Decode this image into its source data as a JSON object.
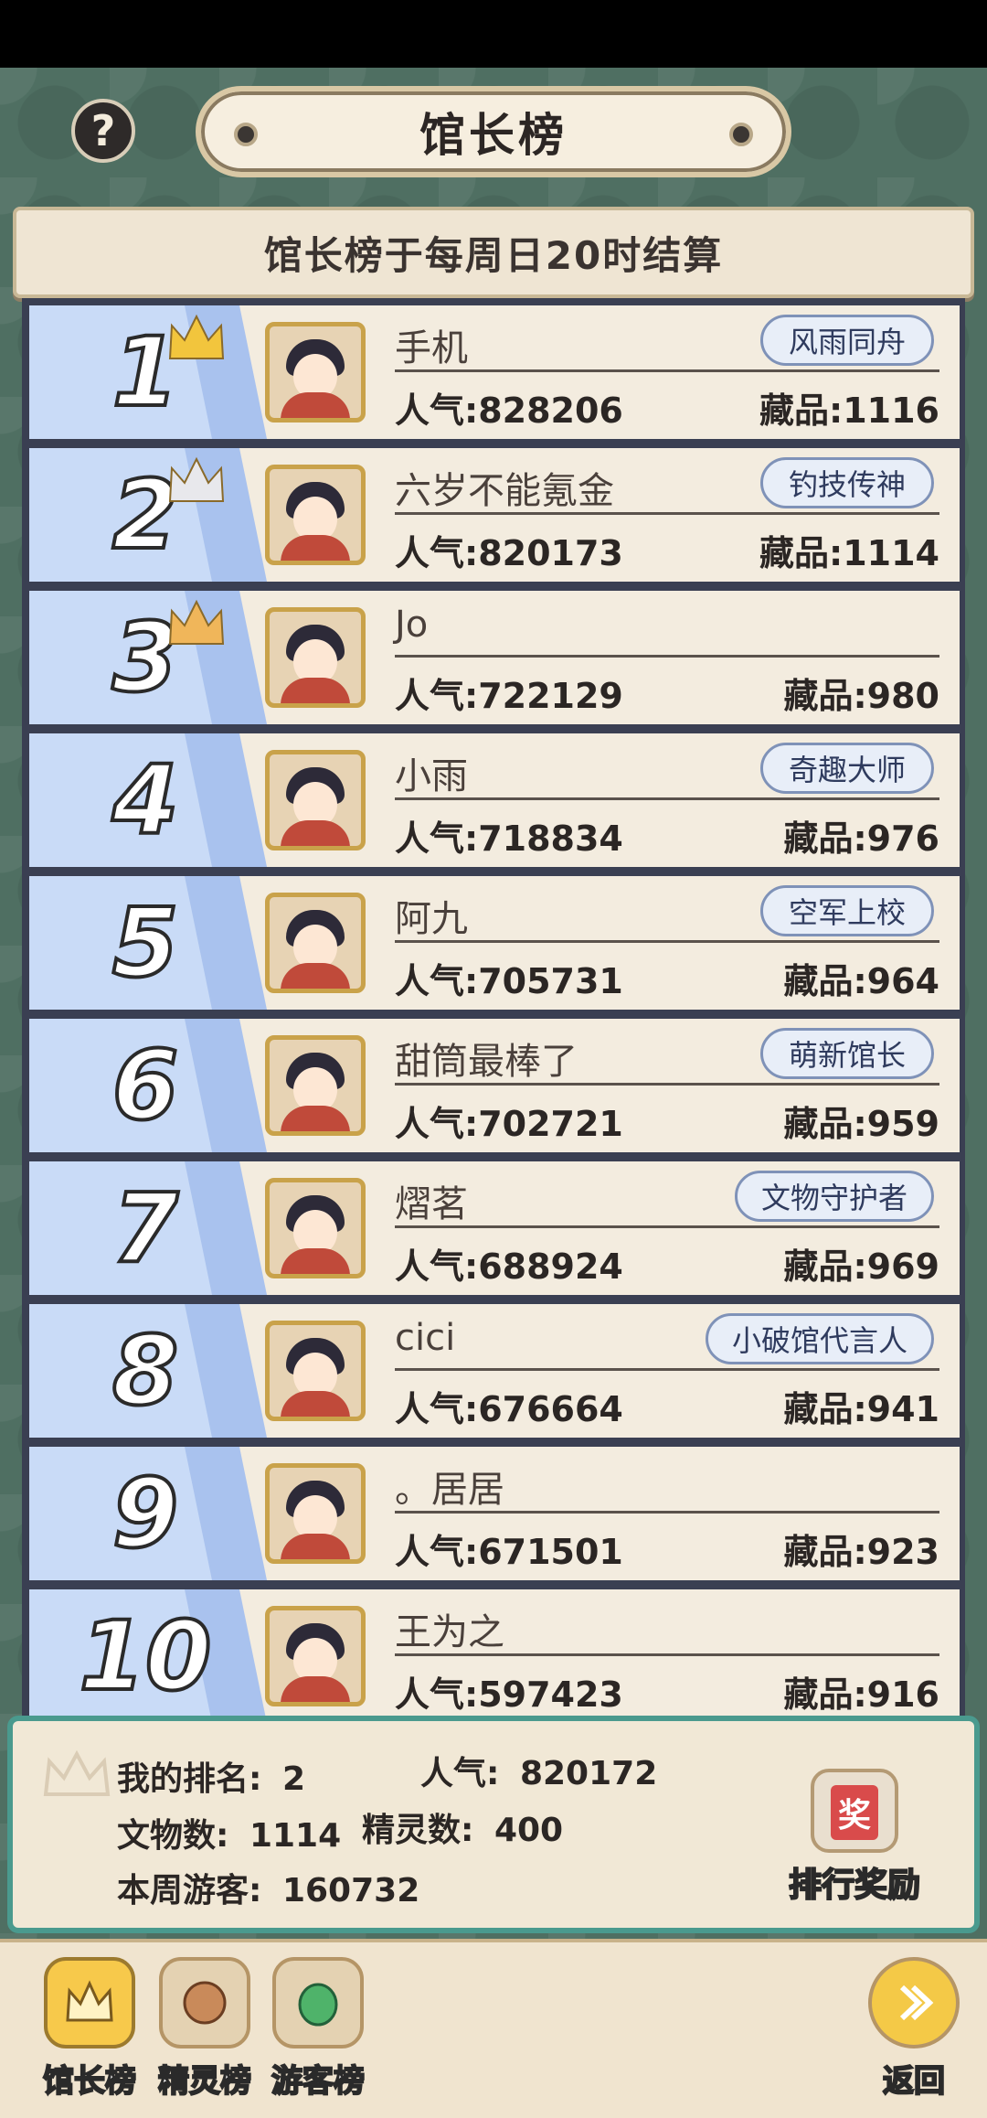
{
  "header": {
    "help_symbol": "?",
    "title": "馆长榜",
    "notice": "馆长榜于每周日20时结算"
  },
  "rows": [
    {
      "rank": "1",
      "name": "手机",
      "popularity": "人气:828206",
      "collection": "藏品:1116",
      "badge": "风雨同舟",
      "crown": "gold"
    },
    {
      "rank": "2",
      "name": "六岁不能氪金",
      "popularity": "人气:820173",
      "collection": "藏品:1114",
      "badge": "钓技传神",
      "crown": "silver"
    },
    {
      "rank": "3",
      "name": "Jo",
      "popularity": "人气:722129",
      "collection": "藏品:980",
      "badge": "",
      "crown": "bronze"
    },
    {
      "rank": "4",
      "name": "小雨",
      "popularity": "人气:718834",
      "collection": "藏品:976",
      "badge": "奇趣大师",
      "crown": ""
    },
    {
      "rank": "5",
      "name": "阿九",
      "popularity": "人气:705731",
      "collection": "藏品:964",
      "badge": "空军上校",
      "crown": ""
    },
    {
      "rank": "6",
      "name": "甜筒最棒了",
      "popularity": "人气:702721",
      "collection": "藏品:959",
      "badge": "萌新馆长",
      "crown": ""
    },
    {
      "rank": "7",
      "name": "熠茗",
      "popularity": "人气:688924",
      "collection": "藏品:969",
      "badge": "文物守护者",
      "crown": ""
    },
    {
      "rank": "8",
      "name": "cici",
      "popularity": "人气:676664",
      "collection": "藏品:941",
      "badge": "小破馆代言人",
      "crown": ""
    },
    {
      "rank": "9",
      "name": "。居居",
      "popularity": "人气:671501",
      "collection": "藏品:923",
      "badge": "",
      "crown": ""
    },
    {
      "rank": "10",
      "name": "王为之",
      "popularity": "人气:597423",
      "collection": "藏品:916",
      "badge": "",
      "crown": ""
    }
  ],
  "my_rank": {
    "rank_label": "我的排名:",
    "rank_value": "2",
    "popularity_label": "人气:",
    "popularity_value": "820172",
    "relics_label": "文物数:",
    "relics_value": "1114",
    "spirits_label": "精灵数:",
    "spirits_value": "400",
    "visitors_label": "本周游客:",
    "visitors_value": "160732",
    "reward_button": "排行奖励"
  },
  "tabs": [
    {
      "label": "馆长榜",
      "active": true
    },
    {
      "label": "精灵榜",
      "active": false
    },
    {
      "label": "游客榜",
      "active": false
    }
  ],
  "back_button": "返回",
  "colors": {
    "rank_blue": "#a9c2ee",
    "panel_border": "#4a9a8e",
    "crown_gold": "#f2c53d",
    "crown_silver": "#e8e8ec",
    "crown_bronze": "#f0b65a"
  }
}
